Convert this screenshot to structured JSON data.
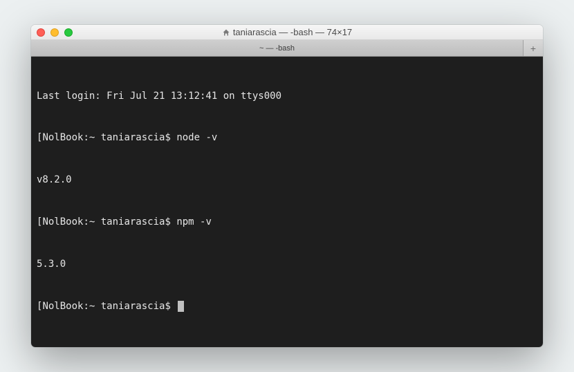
{
  "window": {
    "title": "taniarascia — -bash — 74×17"
  },
  "tabbar": {
    "tab_label": "~ — -bash",
    "newtab_label": "+"
  },
  "terminal": {
    "last_login": "Last login: Fri Jul 21 13:12:41 on ttys000",
    "lines": [
      {
        "prompt_host": "NolBook:",
        "prompt_path": "~ taniarascia",
        "prompt_symbol": "$",
        "command": "node -v"
      },
      {
        "output": "v8.2.0"
      },
      {
        "prompt_host": "NolBook:",
        "prompt_path": "~ taniarascia",
        "prompt_symbol": "$",
        "command": "npm -v"
      },
      {
        "output": "5.3.0"
      },
      {
        "prompt_host": "NolBook:",
        "prompt_path": "~ taniarascia",
        "prompt_symbol": "$",
        "command": "",
        "cursor": true
      }
    ],
    "bracket_left": "[",
    "bracket_right": "]"
  }
}
